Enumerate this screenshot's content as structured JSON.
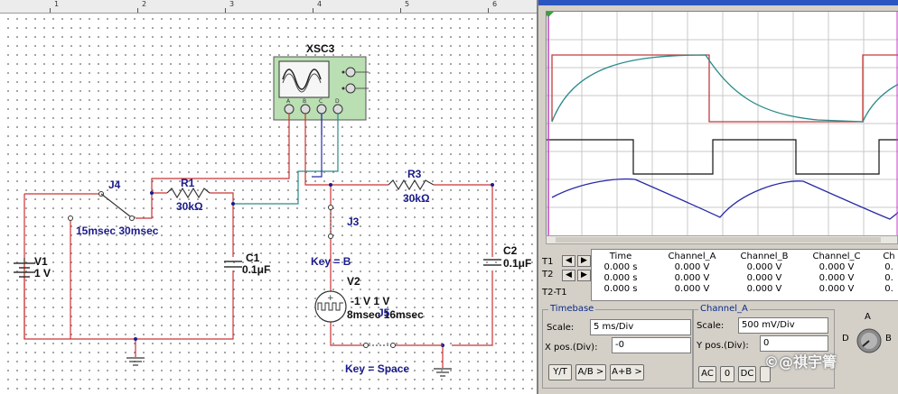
{
  "ruler": {
    "ticks": [
      "1",
      "2",
      "3",
      "4",
      "5",
      "6"
    ]
  },
  "schematic": {
    "oscilloscope": {
      "name": "XSC3",
      "terminals": [
        "A",
        "B",
        "C",
        "D"
      ]
    },
    "components": {
      "j4": {
        "name": "J4",
        "label": "15msec 30msec"
      },
      "r1": {
        "name": "R1",
        "value": "30kΩ"
      },
      "r3": {
        "name": "R3",
        "value": "30kΩ"
      },
      "j3": {
        "name": "J3",
        "key": "Key = B"
      },
      "c1": {
        "name": "C1",
        "value": "0.1μF"
      },
      "c2": {
        "name": "C2",
        "value": "0.1μF"
      },
      "v1": {
        "name": "V1",
        "value": "1 V"
      },
      "v2": {
        "name": "V2",
        "value": "-1 V 1 V",
        "timing": "8msec 16msec"
      },
      "j5": {
        "name": "J5",
        "key": "Key = Space"
      }
    }
  },
  "scope": {
    "readings": {
      "rows": [
        "T1",
        "T2",
        "T2-T1"
      ],
      "columns": [
        {
          "header": "Time",
          "values": [
            "0.000 s",
            "0.000 s",
            "0.000 s"
          ]
        },
        {
          "header": "Channel_A",
          "values": [
            "0.000 V",
            "0.000 V",
            "0.000 V"
          ]
        },
        {
          "header": "Channel_B",
          "values": [
            "0.000 V",
            "0.000 V",
            "0.000 V"
          ]
        },
        {
          "header": "Channel_C",
          "values": [
            "0.000 V",
            "0.000 V",
            "0.000 V"
          ]
        },
        {
          "header": "Ch",
          "values": [
            "0.",
            "0.",
            "0."
          ]
        }
      ]
    },
    "timebase": {
      "title": "Timebase",
      "scale_label": "Scale:",
      "scale_value": "5 ms/Div",
      "xpos_label": "X pos.(Div):",
      "xpos_value": "-0",
      "buttons": [
        "Y/T",
        "A/B >",
        "A+B >"
      ]
    },
    "channel_a": {
      "title": "Channel_A",
      "scale_label": "Scale:",
      "scale_value": "500 mV/Div",
      "ypos_label": "Y pos.(Div):",
      "ypos_value": "0",
      "coupling": [
        "AC",
        "0",
        "DC"
      ]
    },
    "knob": {
      "labels": [
        "A",
        "B",
        "D"
      ]
    },
    "colors": {
      "channel_a": "#2a8a8a",
      "channel_b": "#c43b3b",
      "channel_c": "#111111",
      "channel_d": "#2a2aa8"
    }
  },
  "watermark": "©@祺宇箐"
}
